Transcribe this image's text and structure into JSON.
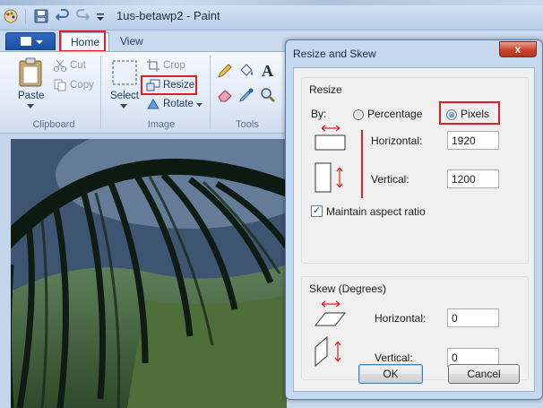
{
  "window": {
    "title": "1us-betawp2 - Paint"
  },
  "ribbon": {
    "tabs": [
      {
        "label": "Home"
      },
      {
        "label": "View"
      }
    ],
    "clipboard": {
      "paste": "Paste",
      "cut": "Cut",
      "copy": "Copy",
      "group": "Clipboard"
    },
    "image": {
      "select": "Select",
      "crop": "Crop",
      "resize": "Resize",
      "rotate": "Rotate",
      "group": "Image"
    },
    "tools": {
      "group": "Tools"
    }
  },
  "dialog": {
    "title": "Resize and Skew",
    "close": "x",
    "resize": {
      "title": "Resize",
      "by_label": "By:",
      "percentage": "Percentage",
      "pixels": "Pixels",
      "selected_mode": "Pixels",
      "horizontal_label": "Horizontal:",
      "horizontal_value": "1920",
      "vertical_label": "Vertical:",
      "vertical_value": "1200",
      "maintain_aspect": "Maintain aspect ratio",
      "maintain_aspect_checked": true
    },
    "skew": {
      "title": "Skew (Degrees)",
      "horizontal_label": "Horizontal:",
      "horizontal_value": "0",
      "vertical_label": "Vertical:",
      "vertical_value": "0"
    },
    "ok": "OK",
    "cancel": "Cancel"
  },
  "colors": {
    "highlight": "#e02020",
    "accent": "#1b4f9e"
  }
}
